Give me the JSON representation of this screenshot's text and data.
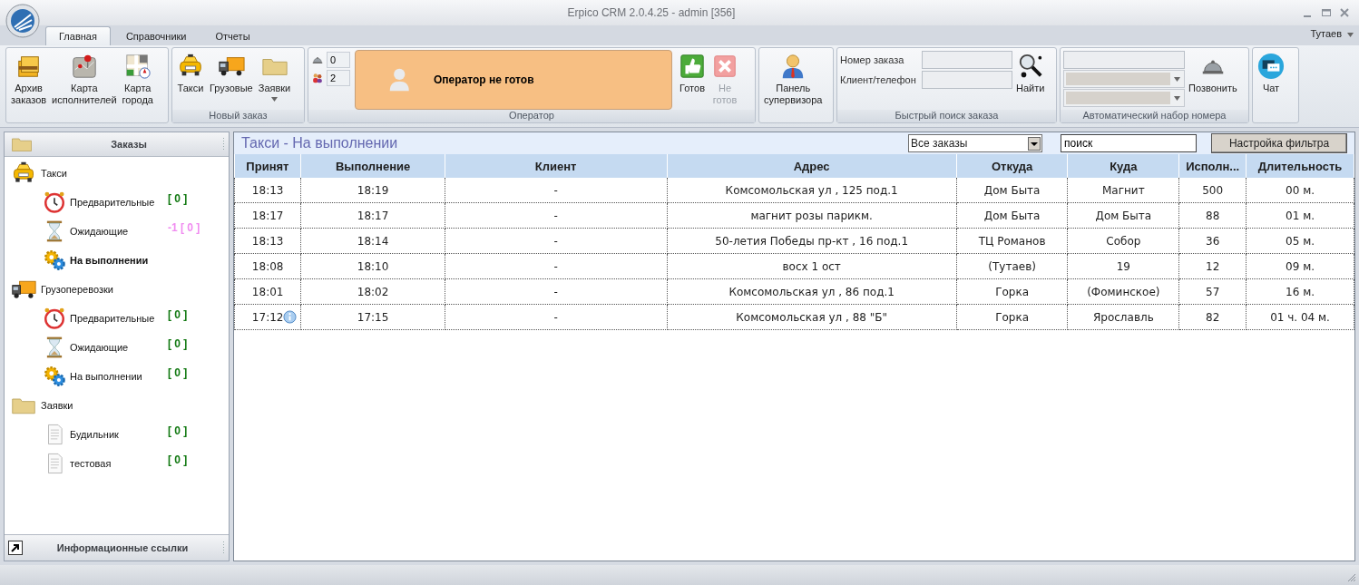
{
  "window": {
    "title": "Erpico CRM 2.0.4.25 - admin [356]"
  },
  "tabs": [
    {
      "label": "Главная",
      "selected": true
    },
    {
      "label": "Справочники",
      "selected": false
    },
    {
      "label": "Отчеты",
      "selected": false
    }
  ],
  "location_menu": {
    "label": "Тутаев"
  },
  "ribbon": [
    {
      "kind": "buttons",
      "buttons": [
        {
          "kind": "archive",
          "label": "Архив\nзаказов",
          "disabled": false,
          "dropdown": false
        },
        {
          "kind": "pinmap",
          "label": "Карта\nисполнителей",
          "disabled": false,
          "dropdown": false
        },
        {
          "kind": "citymap",
          "label": "Карта\nгорода",
          "disabled": false,
          "dropdown": false
        }
      ]
    },
    {
      "kind": "buttons",
      "label": "Новый заказ",
      "buttons": [
        {
          "kind": "taxi",
          "label": "Такси",
          "disabled": false,
          "dropdown": false
        },
        {
          "kind": "truck",
          "label": "Грузовые",
          "disabled": false,
          "dropdown": false
        },
        {
          "kind": "folder",
          "label": "Заявки",
          "disabled": false,
          "dropdown": true
        }
      ]
    },
    {
      "kind": "operator",
      "label": "Оператор",
      "counters": [
        {
          "kind": "bell",
          "value": "0"
        },
        {
          "kind": "people",
          "value": "2"
        }
      ],
      "status": "Оператор не готов",
      "buttons": [
        {
          "kind": "thumb",
          "label": "Готов",
          "disabled": false,
          "dropdown": false
        },
        {
          "kind": "cross",
          "label": "Не\nготов",
          "disabled": true,
          "dropdown": false
        }
      ]
    },
    {
      "kind": "buttons",
      "buttons": [
        {
          "kind": "supervisor",
          "label": "Панель\nсупервизора",
          "disabled": false,
          "dropdown": false
        }
      ]
    },
    {
      "kind": "search",
      "label": "Быстрый поиск заказа",
      "fields": [
        {
          "label": "Номер заказа"
        },
        {
          "label": "Клиент/телефон"
        }
      ],
      "buttons": [
        {
          "kind": "magnifier",
          "label": "Найти",
          "disabled": false,
          "dropdown": false
        }
      ]
    },
    {
      "kind": "dial",
      "label": "Автоматический набор номера",
      "fields": [
        {
          "kind": "text"
        },
        {
          "kind": "combo"
        },
        {
          "kind": "combo"
        }
      ],
      "buttons": [
        {
          "kind": "bell",
          "label": "Позвонить",
          "disabled": false,
          "dropdown": false
        }
      ]
    },
    {
      "kind": "buttons",
      "buttons": [
        {
          "kind": "chat",
          "label": "Чат",
          "disabled": false,
          "dropdown": false
        }
      ]
    }
  ],
  "sidebar": {
    "header": "Заказы",
    "tree": [
      {
        "kind": "taxi",
        "label": "Такси",
        "selected": false,
        "children": [
          {
            "kind": "alarm",
            "label": "Предварительные",
            "count": "[ 0 ]",
            "color": "#107810",
            "selected": false
          },
          {
            "kind": "hourglass",
            "label": "Ожидающие",
            "count": "-1 [ 0 ]",
            "color": "#f08cf0",
            "selected": false
          },
          {
            "kind": "gears",
            "label": "На выполнении",
            "selected": true
          }
        ]
      },
      {
        "kind": "truck",
        "label": "Грузоперевозки",
        "selected": false,
        "children": [
          {
            "kind": "alarm",
            "label": "Предварительные",
            "count": "[ 0 ]",
            "color": "#107810",
            "selected": false
          },
          {
            "kind": "hourglass",
            "label": "Ожидающие",
            "count": "[ 0 ]",
            "color": "#107810",
            "selected": false
          },
          {
            "kind": "gears",
            "label": "На выполнении",
            "count": "[ 0 ]",
            "color": "#107810",
            "selected": false
          }
        ]
      },
      {
        "kind": "folder",
        "label": "Заявки",
        "selected": false,
        "children": [
          {
            "kind": "document",
            "label": "Будильник",
            "count": "[ 0 ]",
            "color": "#107810",
            "selected": false
          },
          {
            "kind": "document",
            "label": "тестовая",
            "count": "[ 0 ]",
            "color": "#107810",
            "selected": false
          }
        ]
      }
    ],
    "footer": "Информационные ссылки"
  },
  "panel": {
    "title": "Такси - На выполнении",
    "filter": {
      "value": "Все заказы"
    },
    "search": {
      "value": "поиск"
    },
    "filter_button": "Настройка фильтра"
  },
  "table": {
    "columns": [
      "Принят",
      "Выполнение",
      "Клиент",
      "Адрес",
      "Откуда",
      "Куда",
      "Исполн...",
      "Длительность"
    ],
    "rows": [
      {
        "info": false,
        "cells": [
          "18:13",
          "18:19",
          "-",
          "Комсомольская ул , 125 под.1",
          "Дом Быта",
          "Магнит",
          "500",
          "00 м."
        ]
      },
      {
        "info": false,
        "cells": [
          "18:17",
          "18:17",
          "-",
          "магнит розы парикм.",
          "Дом Быта",
          "Дом Быта",
          "88",
          "01 м."
        ]
      },
      {
        "info": false,
        "cells": [
          "18:13",
          "18:14",
          "-",
          "50-летия Победы пр-кт , 16 под.1",
          "ТЦ Романов",
          "Собор",
          "36",
          "05 м."
        ]
      },
      {
        "info": false,
        "cells": [
          "18:08",
          "18:10",
          "-",
          "восх 1 ост",
          "(Тутаев)",
          "19",
          "12",
          "09 м."
        ]
      },
      {
        "info": false,
        "cells": [
          "18:01",
          "18:02",
          "-",
          "Комсомольская ул , 86 под.1",
          "Горка",
          "(Фоминское)",
          "57",
          "16 м."
        ]
      },
      {
        "info": true,
        "cells": [
          "17:12",
          "17:15",
          "-",
          "Комсомольская ул , 88 \"Б\"",
          "Горка",
          "Ярославль",
          "82",
          "01 ч. 04 м."
        ]
      }
    ]
  }
}
